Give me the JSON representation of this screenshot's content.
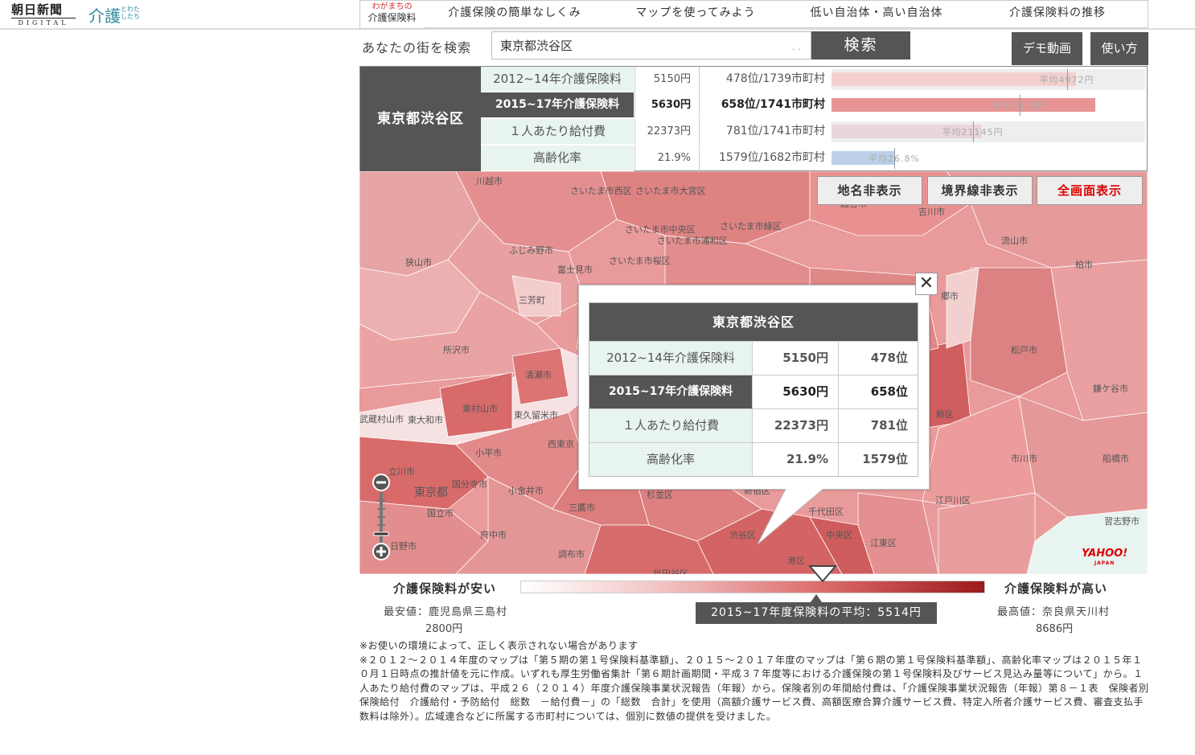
{
  "header": {
    "logo_main": "朝日新聞",
    "logo_sub": "DIGITAL",
    "logo_kaigo": "介護",
    "logo_kaigo_small": "とわたしたち",
    "site_title_small": "わがまちの",
    "site_title_main": "介護保険料",
    "nav": [
      {
        "label": "介護保険の簡単なしくみ"
      },
      {
        "label": "マップを使ってみよう"
      },
      {
        "label": "低い自治体・高い自治体"
      },
      {
        "label": "介護保険料の推移"
      }
    ]
  },
  "search": {
    "label": "あなたの街を検索",
    "value": "東京都渋谷区",
    "button": "検索",
    "demo_button": "デモ動画",
    "howto_button": "使い方"
  },
  "info": {
    "region": "東京都渋谷区",
    "rows": [
      {
        "label": "2012~14年介護保険料",
        "value": "5150円",
        "rank": "478位/1739市町村",
        "bar_fraction": 0.78,
        "avg_fraction": 0.75,
        "avg_label": "平均4972円",
        "bar_color": "#f3cfcf"
      },
      {
        "label": "2015~17年介護保険料",
        "value": "5630円",
        "rank": "658位/1741市町村",
        "bar_fraction": 0.84,
        "avg_fraction": 0.6,
        "avg_label": "平均5514円",
        "bar_color": "#e89494"
      },
      {
        "label": "１人あたり給付費",
        "value": "22373円",
        "rank": "781位/1741市町村",
        "bar_fraction": 0.48,
        "avg_fraction": 0.45,
        "avg_label": "平均21145円",
        "bar_color": "#ead5dc"
      },
      {
        "label": "高齢化率",
        "value": "21.9%",
        "rank": "1579位/1682市町村",
        "bar_fraction": 0.2,
        "avg_fraction": 0.2,
        "avg_label": "平均26.8%",
        "bar_color": "#bcd0ea"
      }
    ]
  },
  "map": {
    "buttons": {
      "hide_names": "地名非表示",
      "hide_borders": "境界線非表示",
      "fullscreen": "全画面表示"
    },
    "labels": [
      {
        "text": "川越市"
      },
      {
        "text": "さいたま市西区"
      },
      {
        "text": "さいたま市大宮区"
      },
      {
        "text": "越谷市"
      },
      {
        "text": "吉川市"
      },
      {
        "text": "さいたま市中央区"
      },
      {
        "text": "さいたま市緑区"
      },
      {
        "text": "さいたま市浦和区"
      },
      {
        "text": "ふじみ野市"
      },
      {
        "text": "流山市"
      },
      {
        "text": "狭山市"
      },
      {
        "text": "富士見市"
      },
      {
        "text": "さいたま市桜区"
      },
      {
        "text": "柏市"
      },
      {
        "text": "三芳町"
      },
      {
        "text": "郷市"
      },
      {
        "text": "所沢市"
      },
      {
        "text": "松戸市"
      },
      {
        "text": "清瀬市"
      },
      {
        "text": "鎌ケ谷市"
      },
      {
        "text": "東村山市"
      },
      {
        "text": "武蔵村山市"
      },
      {
        "text": "東大和市"
      },
      {
        "text": "東久留米市"
      },
      {
        "text": "飾区"
      },
      {
        "text": "西東京"
      },
      {
        "text": "小平市"
      },
      {
        "text": "市川市"
      },
      {
        "text": "船橋市"
      },
      {
        "text": "立川市"
      },
      {
        "text": "国分寺市"
      },
      {
        "text": "東京都"
      },
      {
        "text": "小金井市"
      },
      {
        "text": "杉並区"
      },
      {
        "text": "新宿区"
      },
      {
        "text": "国立市"
      },
      {
        "text": "三鷹市"
      },
      {
        "text": "千代田区"
      },
      {
        "text": "江戸川区"
      },
      {
        "text": "習志野市"
      },
      {
        "text": "府中市"
      },
      {
        "text": "渋谷区"
      },
      {
        "text": "中央区"
      },
      {
        "text": "江東区"
      },
      {
        "text": "日野市"
      },
      {
        "text": "調布市"
      },
      {
        "text": "港区"
      },
      {
        "text": "世田谷区"
      }
    ],
    "logo": "YAHOO!",
    "logo_sub": "JAPAN"
  },
  "popup": {
    "title": "東京都渋谷区",
    "rows": [
      {
        "label": "2012~14年介護保険料",
        "value": "5150円",
        "rank": "478位"
      },
      {
        "label": "2015~17年介護保険料",
        "value": "5630円",
        "rank": "658位"
      },
      {
        "label": "１人あたり給付費",
        "value": "22373円",
        "rank": "781位"
      },
      {
        "label": "高齢化率",
        "value": "21.9%",
        "rank": "1579位"
      }
    ]
  },
  "legend": {
    "low_label": "介護保険料が安い",
    "high_label": "介護保険料が高い",
    "min_label": "最安値：鹿児島県三島村",
    "min_value": "2800円",
    "max_label": "最高値：奈良県天川村",
    "max_value": "8686円",
    "avg_label": "2015~17年度保険料の平均：5514円"
  },
  "notes": [
    "※お使いの環境によって、正しく表示されない場合があります",
    "※２０１２～２０１４年度のマップは「第５期の第１号保険料基準額」、２０１５～２０１７年度のマップは「第６期の第１号保険料基準額」、高齢化率マップは２０１５年１０月１日時点の推計値を元に作成。いずれも厚生労働省集計「第６期計画期間・平成３７年度等における介護保険の第１号保険料及びサービス見込み量等について」から。１人あたり給付費のマップは、平成２６（２０１４）年度介護保険事業状況報告（年報）から。保険者別の年間給付費は、「介護保険事業状況報告（年報）第８－１表　保険者別　保険給付　介護給付・予防給付　総数　－給付費－」の「総数　合計」を使用（高額介護サービス費、高額医療合算介護サービス費、特定入所者介護サービス費、審査支払手数料は除外）。広域連合などに所属する市町村については、個別に数値の提供を受けました。"
  ]
}
